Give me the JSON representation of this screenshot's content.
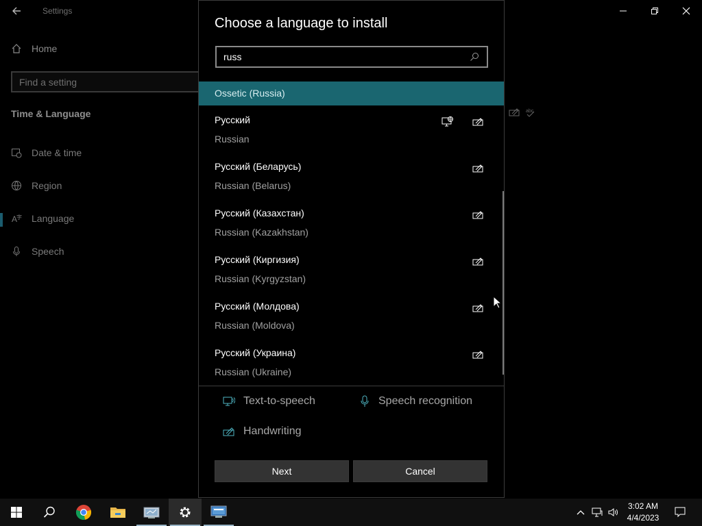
{
  "settings": {
    "app_title": "Settings",
    "nav_home": "Home",
    "search_placeholder": "Find a setting",
    "section_title": "Time & Language",
    "nav_items": [
      {
        "label": "Date & time",
        "icon": "calendar-clock-icon"
      },
      {
        "label": "Region",
        "icon": "globe-icon"
      },
      {
        "label": "Language",
        "icon": "language-icon",
        "active": true
      },
      {
        "label": "Speech",
        "icon": "microphone-icon"
      }
    ]
  },
  "dialog": {
    "title": "Choose a language to install",
    "search_value": "russ",
    "languages": [
      {
        "native": "Ossetic (Russia)",
        "english": "",
        "selected": true,
        "features": []
      },
      {
        "native": "Русский",
        "english": "Russian",
        "features": [
          "display-language-icon",
          "handwriting-icon"
        ]
      },
      {
        "native": "Русский (Беларусь)",
        "english": "Russian (Belarus)",
        "features": [
          "handwriting-icon"
        ]
      },
      {
        "native": "Русский (Казахстан)",
        "english": "Russian (Kazakhstan)",
        "features": [
          "handwriting-icon"
        ]
      },
      {
        "native": "Русский (Киргизия)",
        "english": "Russian (Kyrgyzstan)",
        "features": [
          "handwriting-icon"
        ]
      },
      {
        "native": "Русский (Молдова)",
        "english": "Russian (Moldova)",
        "features": [
          "handwriting-icon"
        ]
      },
      {
        "native": "Русский (Украина)",
        "english": "Russian (Ukraine)",
        "features": [
          "handwriting-icon"
        ]
      }
    ],
    "legend": {
      "tts": "Text-to-speech",
      "speech": "Speech recognition",
      "handwriting": "Handwriting"
    },
    "buttons": {
      "next": "Next",
      "cancel": "Cancel"
    }
  },
  "taskbar": {
    "apps": [
      "start-icon",
      "search-icon",
      "chrome-icon",
      "file-explorer-icon",
      "network-app-icon",
      "settings-gear-icon",
      "remote-desktop-icon"
    ],
    "active_app": "settings-gear-icon",
    "time": "3:02 AM",
    "date": "4/4/2023"
  },
  "colors": {
    "accent": "#1a6670",
    "dialog_bg": "#000000",
    "button_bg": "#333333",
    "taskbar_bg": "#101010"
  }
}
